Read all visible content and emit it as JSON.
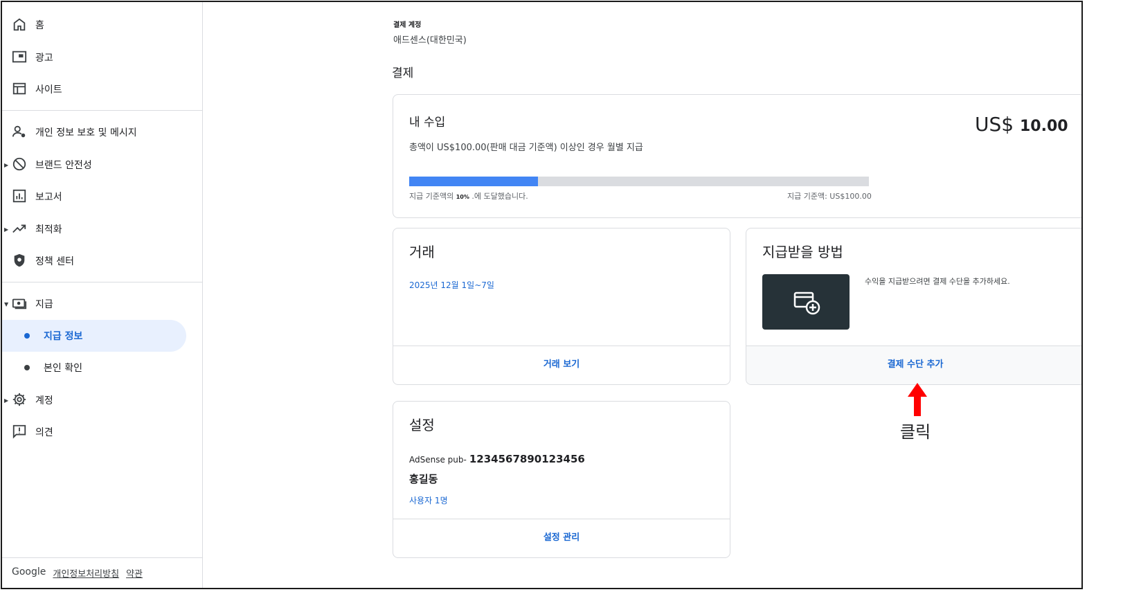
{
  "sidebar": {
    "items": [
      {
        "label": "홈",
        "icon": "home-icon"
      },
      {
        "label": "광고",
        "icon": "ads-icon"
      },
      {
        "label": "사이트",
        "icon": "sites-icon"
      },
      {
        "label": "개인 정보 보호 및 메시지",
        "icon": "privacy-icon"
      },
      {
        "label": "브랜드 안전성",
        "icon": "block-icon"
      },
      {
        "label": "보고서",
        "icon": "reports-icon"
      },
      {
        "label": "최적화",
        "icon": "trending-icon"
      },
      {
        "label": "정책 센터",
        "icon": "shield-icon"
      },
      {
        "label": "지급",
        "icon": "payments-icon"
      },
      {
        "label": "지급 정보"
      },
      {
        "label": "본인 확인"
      },
      {
        "label": "계정",
        "icon": "gear-icon"
      },
      {
        "label": "의견",
        "icon": "feedback-icon"
      }
    ]
  },
  "footer": {
    "brand": "Google",
    "privacy": "개인정보처리방침",
    "terms": "약관"
  },
  "account": {
    "label": "결제 계정",
    "name": "애드센스(대한민국)"
  },
  "section_title": "결제",
  "earnings": {
    "title": "내 수입",
    "description": "총액이 US$100.00(판매 대금 기준액) 이상인 경우 월별 지급",
    "currency": "US$",
    "amount": "10.00",
    "progress_fraction": 0.28,
    "progress_prefix": "지급 기준액의",
    "progress_percent": "10%",
    "progress_suffix": ".에 도달했습니다.",
    "threshold": "지급 기준액: US$100.00"
  },
  "transactions": {
    "title": "거래",
    "date_range": "2025년 12월 1일~7일",
    "action": "거래 보기"
  },
  "payment_method": {
    "title": "지급받을 방법",
    "hint": "수익을 지급받으려면 결제 수단을 추가하세요.",
    "action": "결제 수단 추가"
  },
  "settings": {
    "title": "설정",
    "pub_prefix": "AdSense pub-",
    "pub_id": "1234567890123456",
    "user_name": "홍길동",
    "users": "사용자 1명",
    "action": "설정 관리"
  },
  "annotation": {
    "text": "클릭",
    "color": "#ff0000"
  },
  "colors": {
    "accent": "#1967d2",
    "progress": "#4285f4",
    "active_bg": "#e8f0fe",
    "tile": "#263238"
  }
}
